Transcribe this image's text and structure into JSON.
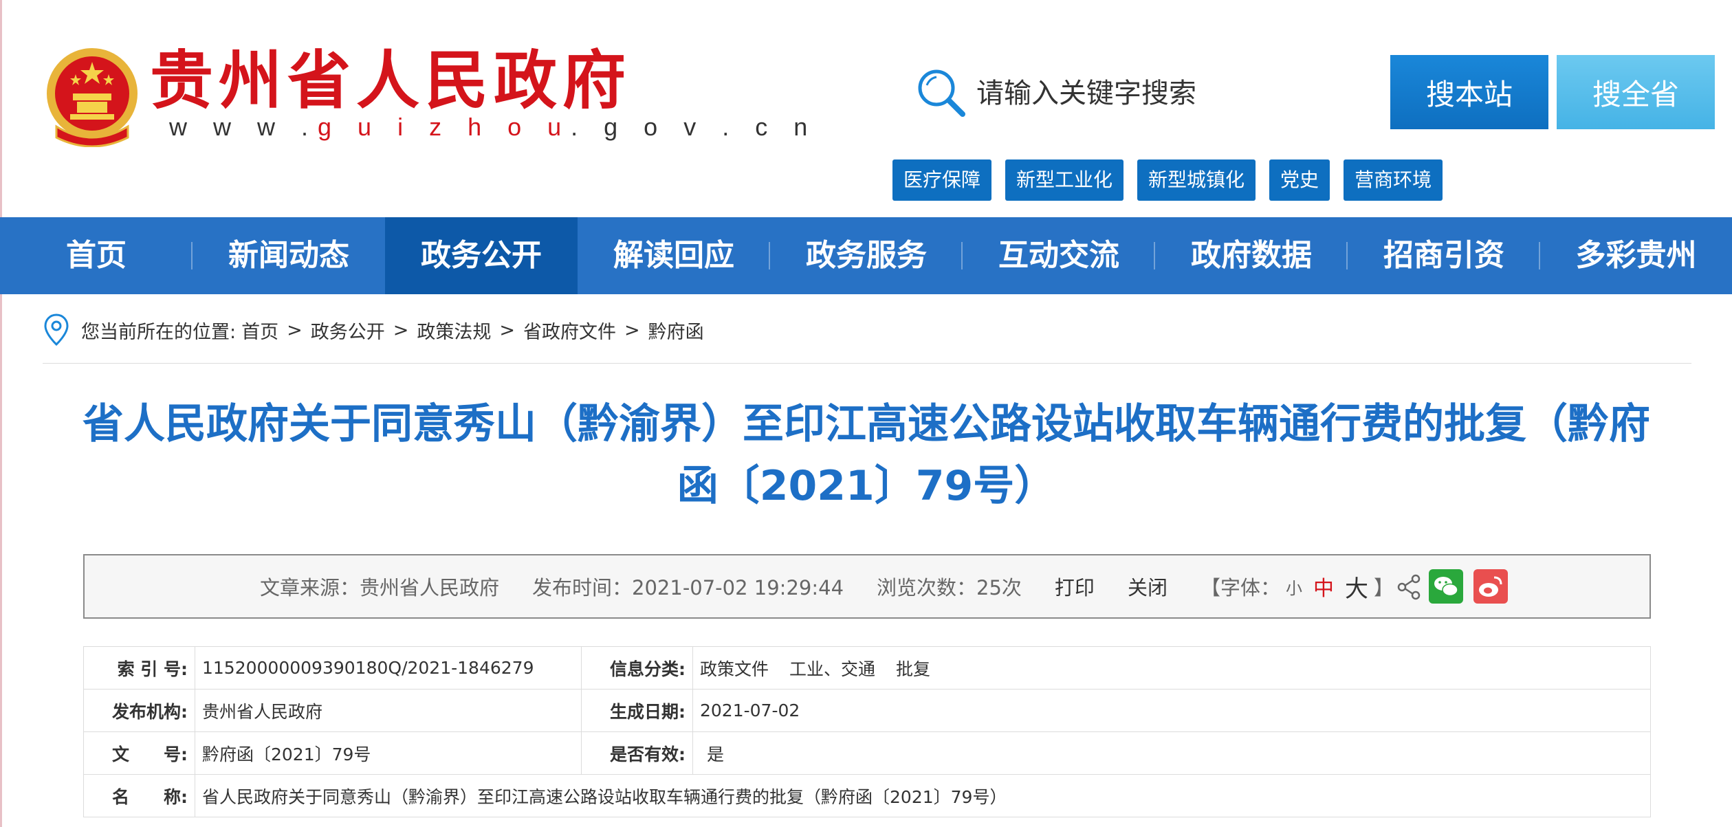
{
  "header": {
    "site_title": "贵州省人民政府",
    "site_domain_prefix": "w w w .",
    "site_domain_highlight": "g u i z h o u",
    "site_domain_suffix": ". g o v . c n",
    "search": {
      "placeholder": "请输入关键字搜索",
      "btn_site": "搜本站",
      "btn_province": "搜全省"
    },
    "tags": [
      "医疗保障",
      "新型工业化",
      "新型城镇化",
      "党史",
      "营商环境"
    ]
  },
  "colors": {
    "brand_red": "#d4141b",
    "nav_blue": "#2872c5",
    "nav_active": "#0d59a8",
    "title_blue": "#1d6fc6"
  },
  "nav": {
    "items": [
      {
        "label": "首页"
      },
      {
        "label": "新闻动态"
      },
      {
        "label": "政务公开",
        "active": true
      },
      {
        "label": "解读回应"
      },
      {
        "label": "政务服务"
      },
      {
        "label": "互动交流"
      },
      {
        "label": "政府数据"
      },
      {
        "label": "招商引资"
      },
      {
        "label": "多彩贵州"
      }
    ]
  },
  "breadcrumb": {
    "prefix": "您当前所在的位置:",
    "items": [
      "首页",
      "政务公开",
      "政策法规",
      "省政府文件",
      "黔府函"
    ],
    "separator": ">"
  },
  "document": {
    "title": "省人民政府关于同意秀山（黔渝界）至印江高速公路设站收取车辆通行费的批复（黔府函〔2021〕79号）"
  },
  "meta": {
    "source": "文章来源：贵州省人民政府",
    "published": "发布时间：2021-07-02 19:29:44",
    "views": "浏览次数：25次",
    "print": "打印",
    "close": "关闭",
    "font_label": "【字体：",
    "font_small": "小",
    "font_mid": "中",
    "font_large": "大",
    "font_end": "】"
  },
  "info": {
    "index_label": "索 引 号:",
    "index_value": "11520000009390180Q/2021-1846279",
    "category_label": "信息分类:",
    "category_values": [
      "政策文件",
      "工业、交通",
      "批复"
    ],
    "issuer_label": "发布机构:",
    "issuer_value": "贵州省人民政府",
    "date_label": "生成日期:",
    "date_value": "2021-07-02",
    "docno_label": "文　　号:",
    "docno_value": "黔府函〔2021〕79号",
    "valid_label": "是否有效:",
    "valid_value": "是",
    "name_label": "名　　称:",
    "name_value": "省人民政府关于同意秀山（黔渝界）至印江高速公路设站收取车辆通行费的批复（黔府函〔2021〕79号）"
  }
}
